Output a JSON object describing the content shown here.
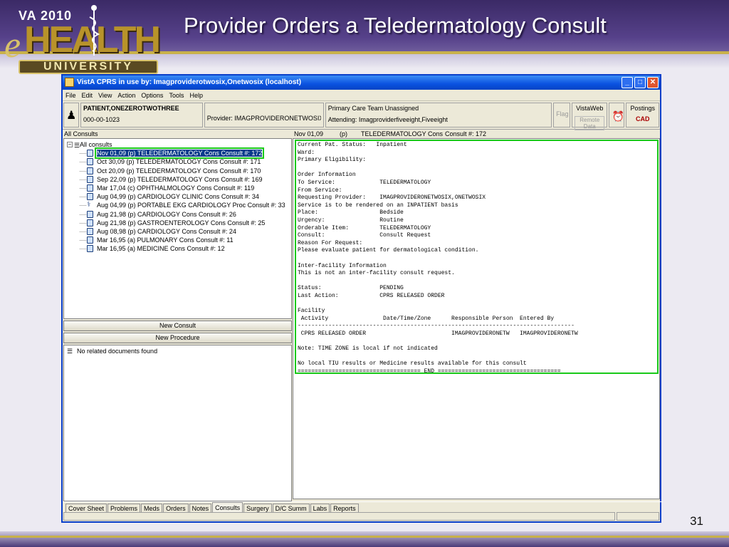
{
  "slide": {
    "title": "Provider Orders a Teledermatology Consult",
    "page_number": "31",
    "logo": {
      "top": "VA 2010",
      "e": "e",
      "health": "HEALTH",
      "bottom": "UNIVERSITY"
    }
  },
  "window": {
    "title": "VistA CPRS in use by: Imagproviderotwosix,Onetwosix  (localhost)",
    "controls": {
      "minimize": "_",
      "maximize": "□",
      "close": "✕"
    },
    "menu": [
      "File",
      "Edit",
      "View",
      "Action",
      "Options",
      "Tools",
      "Help"
    ]
  },
  "patient": {
    "name": "PATIENT,ONEZEROTWOTHREE",
    "ssn": "000-00-1023",
    "provider": "Provider:  IMAGPROVIDERONETWOSIX,ONE",
    "team": "Primary Care Team Unassigned",
    "attending": "Attending:  Imagproviderfiveeight,Fiveeight",
    "flag": "Flag",
    "vistaweb": "VistaWeb",
    "remote_data": "Remote Data",
    "postings": "Postings",
    "cad": "CAD"
  },
  "consults": {
    "header": "All Consults",
    "root": "All consults",
    "items": [
      {
        "text": "Nov 01,09  (p)  TELEDERMATOLOGY Cons Consult #: 172",
        "selected": true
      },
      {
        "text": "Oct 30,09  (p)  TELEDERMATOLOGY Cons Consult #: 171"
      },
      {
        "text": "Oct 20,09  (p)  TELEDERMATOLOGY Cons Consult #: 170"
      },
      {
        "text": "Sep 22,09  (p)  TELEDERMATOLOGY Cons Consult #: 169"
      },
      {
        "text": "Mar 17,04  (c)  OPHTHALMOLOGY Cons Consult #: 119"
      },
      {
        "text": "Aug 04,99  (p)  CARDIOLOGY CLINIC Cons Consult #: 34"
      },
      {
        "text": "Aug 04,99  (p)  PORTABLE EKG CARDIOLOGY Proc Consult #: 33",
        "icon": "ekg"
      },
      {
        "text": "Aug 21,98  (p)  CARDIOLOGY Cons Consult #: 26"
      },
      {
        "text": "Aug 21,98  (p)  GASTROENTEROLOGY Cons Consult #: 25"
      },
      {
        "text": "Aug 08,98  (p)  CARDIOLOGY Cons Consult #: 24"
      },
      {
        "text": "Mar 16,95  (a)  PULMONARY Cons Consult #: 11"
      },
      {
        "text": "Mar 16,95  (a)  MEDICINE Cons Consult #: 12"
      }
    ],
    "new_consult": "New Consult",
    "new_procedure": "New Procedure",
    "related": "No related documents found"
  },
  "detail": {
    "header": {
      "date": "Nov 01,09",
      "status": "(p)",
      "service": "TELEDERMATOLOGY Cons",
      "consult": "Consult #: 172"
    },
    "text": "Current Pat. Status:   Inpatient\nWard:\nPrimary Eligibility:\n\nOrder Information\nTo Service:             TELEDERMATOLOGY\nFrom Service:\nRequesting Provider:    IMAGPROVIDERONETWOSIX,ONETWOSIX\nService is to be rendered on an INPATIENT basis\nPlace:                  Bedside\nUrgency:                Routine\nOrderable Item:         TELEDERMATOLOGY\nConsult:                Consult Request\nReason For Request:\nPlease evaluate patient for dermatological condition.\n\nInter-facility Information\nThis is not an inter-facility consult request.\n\nStatus:                 PENDING\nLast Action:            CPRS RELEASED ORDER\n\nFacility\n Activity                Date/Time/Zone      Responsible Person  Entered By\n---------------------------------------------------------------------------------\n CPRS RELEASED ORDER                         IMAGPROVIDERONETW   IMAGPROVIDERONETW\n\nNote: TIME ZONE is local if not indicated\n\nNo local TIU results or Medicine results available for this consult\n==================================== END ===================================="
  },
  "tabs": [
    {
      "label": "Cover Sheet"
    },
    {
      "label": "Problems"
    },
    {
      "label": "Meds"
    },
    {
      "label": "Orders"
    },
    {
      "label": "Notes"
    },
    {
      "label": "Consults",
      "active": true
    },
    {
      "label": "Surgery"
    },
    {
      "label": "D/C Summ"
    },
    {
      "label": "Labs"
    },
    {
      "label": "Reports"
    }
  ]
}
